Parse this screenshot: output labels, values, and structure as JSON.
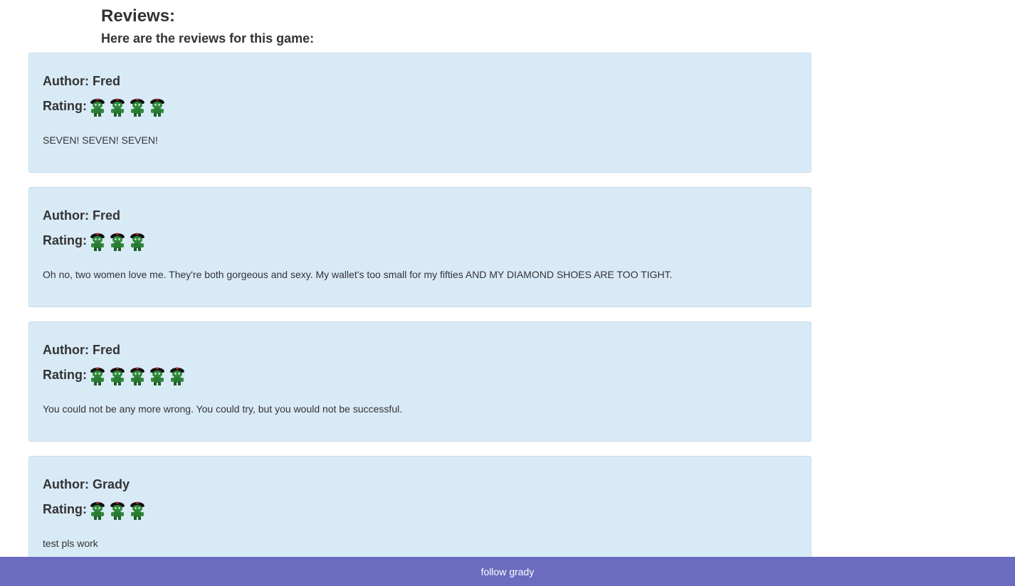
{
  "page": {
    "title": "Reviews:",
    "subtitle": "Here are the reviews for this game:"
  },
  "reviews": [
    {
      "author_label": "Author: Fred",
      "rating_label": "Rating:",
      "rating": 4,
      "text": "SEVEN! SEVEN! SEVEN!"
    },
    {
      "author_label": "Author: Fred",
      "rating_label": "Rating:",
      "rating": 3,
      "text": "Oh no, two women love me. They're both gorgeous and sexy. My wallet's too small for my fifties AND MY DIAMOND SHOES ARE TOO TIGHT."
    },
    {
      "author_label": "Author: Fred",
      "rating_label": "Rating:",
      "rating": 5,
      "text": "You could not be any more wrong. You could try, but you would not be successful."
    },
    {
      "author_label": "Author: Grady",
      "rating_label": "Rating:",
      "rating": 3,
      "text": "test pls work"
    }
  ],
  "rating_icon": "green-goblin-soldier-icon",
  "footer": {
    "link_label": "follow grady"
  },
  "colors": {
    "card_background": "#d9eaf7",
    "footer_background": "#6b6bbf",
    "footer_text": "#ffffff",
    "text": "#333333"
  }
}
